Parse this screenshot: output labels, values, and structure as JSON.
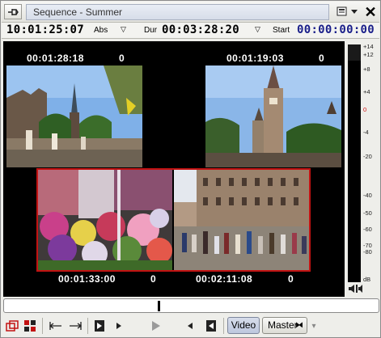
{
  "window": {
    "title": "Sequence - Summer",
    "pin_icon": "pin-icon",
    "menu_icon": "window-menu-icon",
    "close_icon": "close-icon"
  },
  "timecodes": {
    "current": "10:01:25:07",
    "mode": "Abs",
    "dur_label": "Dur",
    "duration": "00:03:28:20",
    "start_label": "Start",
    "start": "00:00:00:00",
    "dropdown_glyph": "▽"
  },
  "quad": [
    {
      "timecode": "00:01:28:18",
      "frames": "0"
    },
    {
      "timecode": "00:01:19:03",
      "frames": "0"
    },
    {
      "timecode": "00:01:33:00",
      "frames": "0"
    },
    {
      "timecode": "00:02:11:08",
      "frames": "0"
    }
  ],
  "meter": {
    "ticks": [
      "+14",
      "+12",
      "+8",
      "+4",
      "0",
      "-4",
      "-20",
      "-40",
      "-50",
      "-60",
      "-70",
      "-80",
      "dB"
    ],
    "zero_color": "#d01010",
    "speaker_icon": "speaker-icon"
  },
  "toolbar": {
    "video_label": "Video",
    "master_label": "Master",
    "master_icon": "link-icon"
  },
  "colors": {
    "selection": "#c21212",
    "start_timecode": "#1a1f8a"
  }
}
